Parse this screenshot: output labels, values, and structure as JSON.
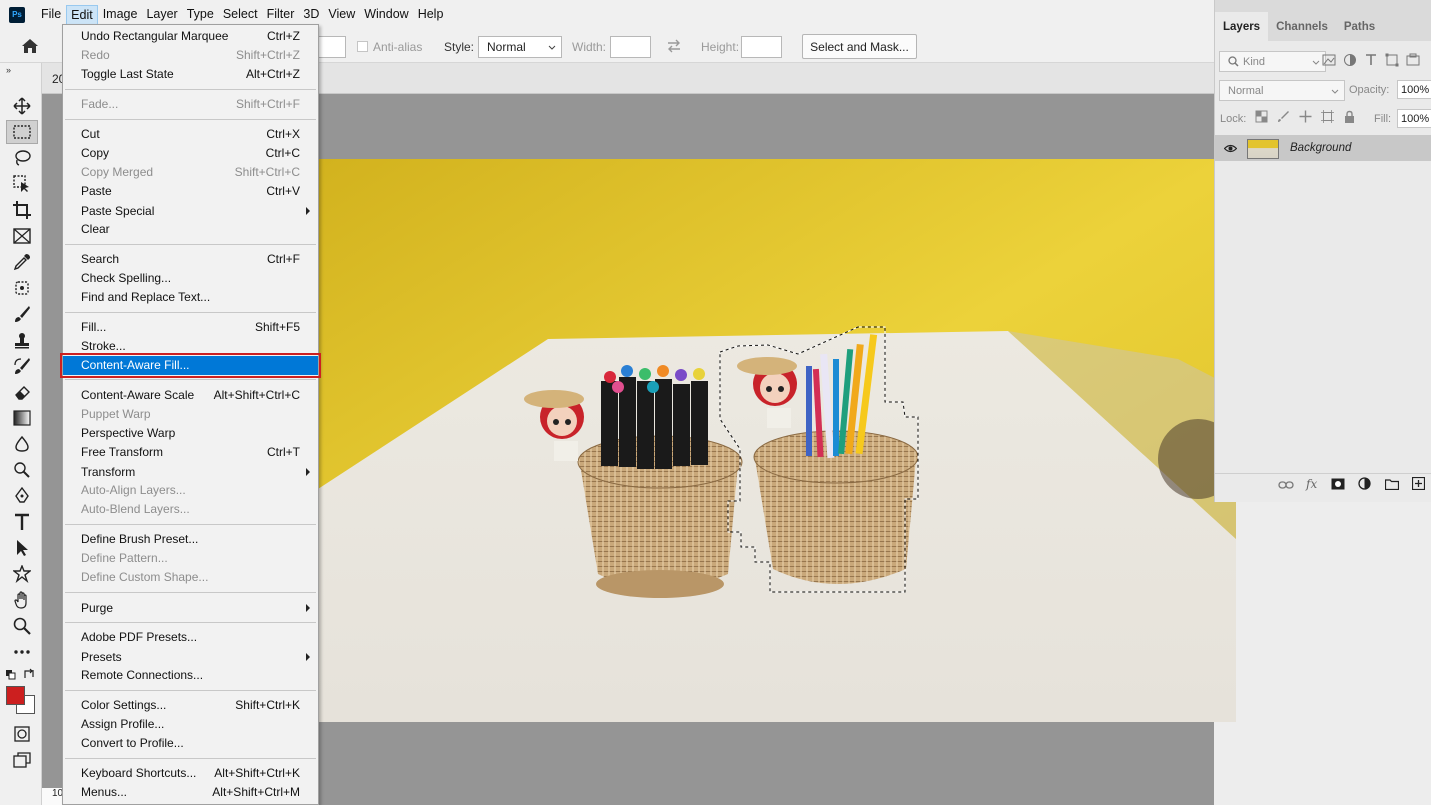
{
  "app": {
    "logo": "Ps"
  },
  "menubar": [
    {
      "id": "file",
      "label": "File"
    },
    {
      "id": "edit",
      "label": "Edit"
    },
    {
      "id": "image",
      "label": "Image"
    },
    {
      "id": "layer",
      "label": "Layer"
    },
    {
      "id": "type",
      "label": "Type"
    },
    {
      "id": "select",
      "label": "Select"
    },
    {
      "id": "filter",
      "label": "Filter"
    },
    {
      "id": "3d",
      "label": "3D"
    },
    {
      "id": "view",
      "label": "View"
    },
    {
      "id": "window",
      "label": "Window"
    },
    {
      "id": "help",
      "label": "Help"
    }
  ],
  "options": {
    "anti_alias": "Anti-alias",
    "style_label": "Style:",
    "style_value": "Normal",
    "width_label": "Width:",
    "height_label": "Height:",
    "select_mask": "Select and Mask..."
  },
  "document": {
    "tab_text": "20",
    "status_zoom": "10"
  },
  "edit_menu": {
    "items": [
      {
        "label": "Undo Rectangular Marquee",
        "shortcut": "Ctrl+Z",
        "enabled": true
      },
      {
        "label": "Redo",
        "shortcut": "Shift+Ctrl+Z",
        "enabled": false
      },
      {
        "label": "Toggle Last State",
        "shortcut": "Alt+Ctrl+Z",
        "enabled": true
      },
      {
        "label": "Fade...",
        "shortcut": "Shift+Ctrl+F",
        "enabled": false
      },
      {
        "label": "Cut",
        "shortcut": "Ctrl+X",
        "enabled": true
      },
      {
        "label": "Copy",
        "shortcut": "Ctrl+C",
        "enabled": true
      },
      {
        "label": "Copy Merged",
        "shortcut": "Shift+Ctrl+C",
        "enabled": false
      },
      {
        "label": "Paste",
        "shortcut": "Ctrl+V",
        "enabled": true
      },
      {
        "label": "Paste Special",
        "shortcut": "",
        "enabled": true,
        "submenu": true
      },
      {
        "label": "Clear",
        "shortcut": "",
        "enabled": true
      },
      {
        "label": "Search",
        "shortcut": "Ctrl+F",
        "enabled": true
      },
      {
        "label": "Check Spelling...",
        "shortcut": "",
        "enabled": true
      },
      {
        "label": "Find and Replace Text...",
        "shortcut": "",
        "enabled": true
      },
      {
        "label": "Fill...",
        "shortcut": "Shift+F5",
        "enabled": true
      },
      {
        "label": "Stroke...",
        "shortcut": "",
        "enabled": true
      },
      {
        "label": "Content-Aware Fill...",
        "shortcut": "",
        "enabled": true,
        "highlighted": true
      },
      {
        "label": "Content-Aware Scale",
        "shortcut": "Alt+Shift+Ctrl+C",
        "enabled": true
      },
      {
        "label": "Puppet Warp",
        "shortcut": "",
        "enabled": false
      },
      {
        "label": "Perspective Warp",
        "shortcut": "",
        "enabled": true
      },
      {
        "label": "Free Transform",
        "shortcut": "Ctrl+T",
        "enabled": true
      },
      {
        "label": "Transform",
        "shortcut": "",
        "enabled": true,
        "submenu": true
      },
      {
        "label": "Auto-Align Layers...",
        "shortcut": "",
        "enabled": false
      },
      {
        "label": "Auto-Blend Layers...",
        "shortcut": "",
        "enabled": false
      },
      {
        "label": "Define Brush Preset...",
        "shortcut": "",
        "enabled": true
      },
      {
        "label": "Define Pattern...",
        "shortcut": "",
        "enabled": false
      },
      {
        "label": "Define Custom Shape...",
        "shortcut": "",
        "enabled": false
      },
      {
        "label": "Purge",
        "shortcut": "",
        "enabled": true,
        "submenu": true
      },
      {
        "label": "Adobe PDF Presets...",
        "shortcut": "",
        "enabled": true
      },
      {
        "label": "Presets",
        "shortcut": "",
        "enabled": true,
        "submenu": true
      },
      {
        "label": "Remote Connections...",
        "shortcut": "",
        "enabled": true
      },
      {
        "label": "Color Settings...",
        "shortcut": "Shift+Ctrl+K",
        "enabled": true
      },
      {
        "label": "Assign Profile...",
        "shortcut": "",
        "enabled": true
      },
      {
        "label": "Convert to Profile...",
        "shortcut": "",
        "enabled": true
      },
      {
        "label": "Keyboard Shortcuts...",
        "shortcut": "Alt+Shift+Ctrl+K",
        "enabled": true
      },
      {
        "label": "Menus...",
        "shortcut": "Alt+Shift+Ctrl+M",
        "enabled": true
      }
    ]
  },
  "layers_panel": {
    "tabs": [
      "Layers",
      "Channels",
      "Paths"
    ],
    "kind": "Kind",
    "blend_mode": "Normal",
    "opacity_label": "Opacity:",
    "opacity_value": "100%",
    "lock_label": "Lock:",
    "fill_label": "Fill:",
    "fill_value": "100%",
    "layer_name": "Background",
    "fx_label": "fx"
  },
  "colors": {
    "accent": "#0078d7",
    "highlight_outline": "#cc2020",
    "foreground": "#cc1f1f",
    "background": "#ffffff"
  }
}
